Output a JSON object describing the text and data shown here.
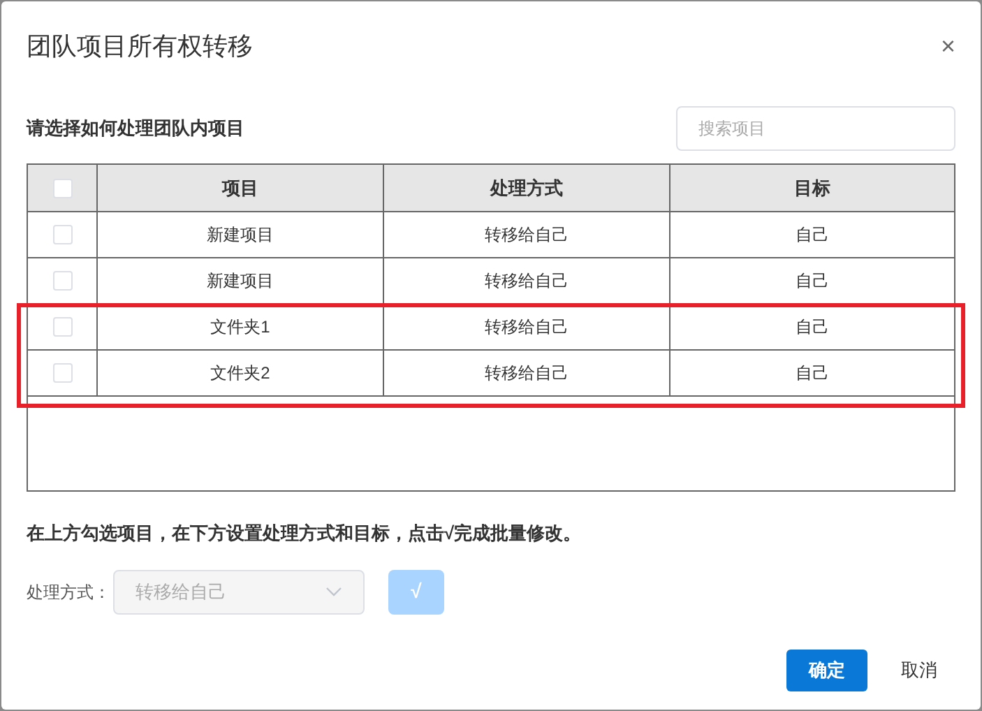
{
  "dialog": {
    "title": "团队项目所有权转移",
    "close": "×"
  },
  "section_label": "请选择如何处理团队内项目",
  "search": {
    "placeholder": "搜索项目"
  },
  "table": {
    "select_all": {
      "checked": false
    },
    "columns": [
      "项目",
      "处理方式",
      "目标"
    ],
    "rows": [
      {
        "checked": false,
        "highlighted": false,
        "cells": [
          "新建项目",
          "转移给自己",
          "自己"
        ]
      },
      {
        "checked": false,
        "highlighted": false,
        "cells": [
          "新建项目",
          "转移给自己",
          "自己"
        ]
      },
      {
        "checked": false,
        "highlighted": true,
        "cells": [
          "文件夹1",
          "转移给自己",
          "自己"
        ]
      },
      {
        "checked": false,
        "highlighted": true,
        "cells": [
          "文件夹2",
          "转移给自己",
          "自己"
        ]
      }
    ]
  },
  "hint": "在上方勾选项目，在下方设置处理方式和目标，点击√完成批量修改。",
  "batch": {
    "label": "处理方式：",
    "select_value": "转移给自己",
    "apply_button": "√",
    "disabled": true
  },
  "buttons": {
    "ok": "确定",
    "cancel": "取消"
  }
}
